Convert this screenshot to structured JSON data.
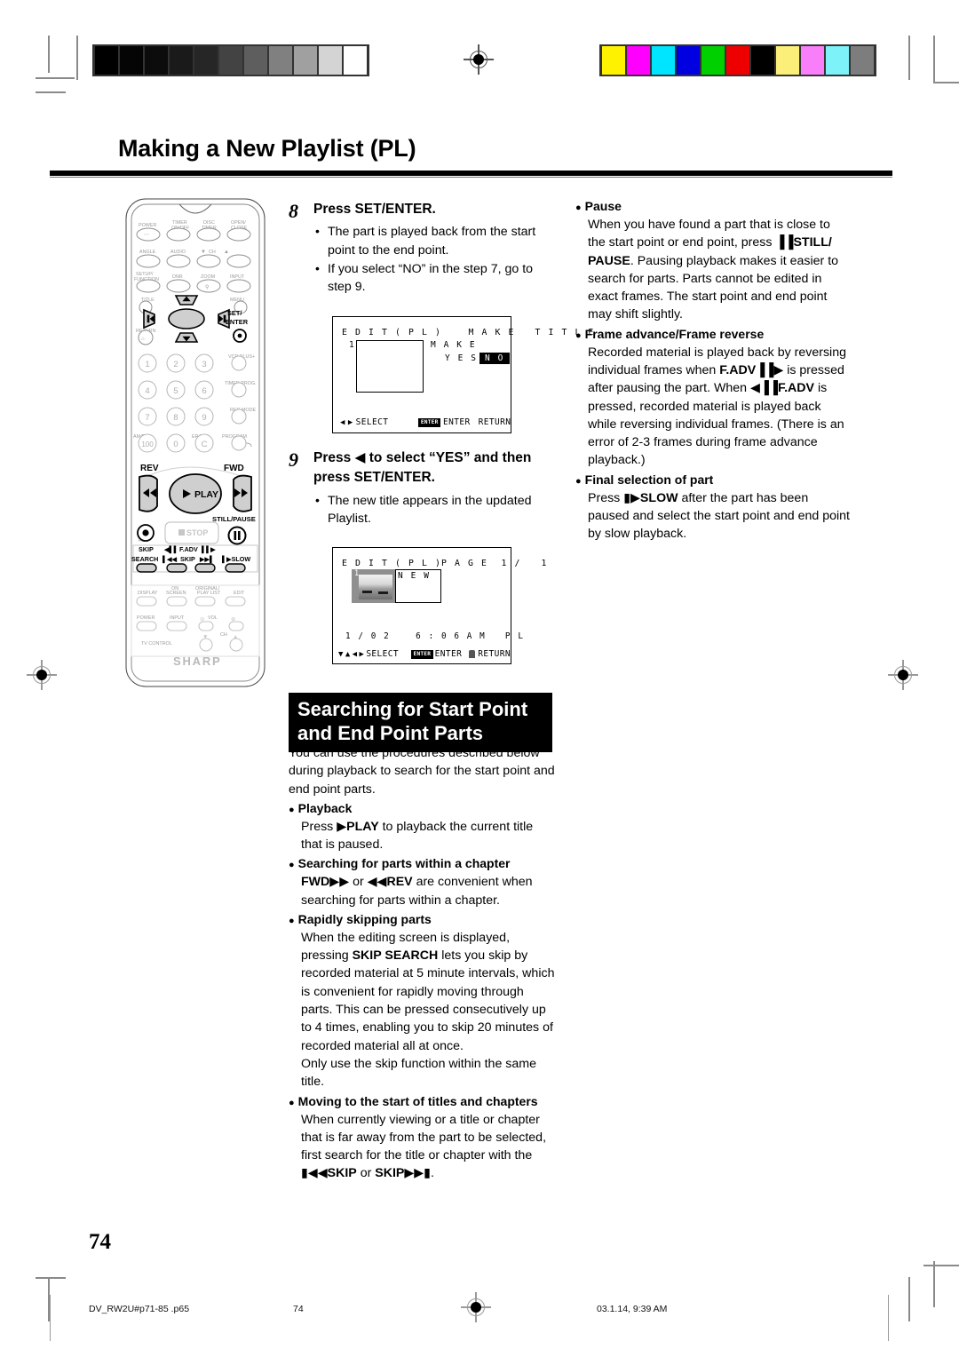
{
  "page": {
    "title": "Making a New Playlist (PL)",
    "number": "74"
  },
  "footer": {
    "filename": "DV_RW2U#p71-85 .p65",
    "page": "74",
    "timestamp": "03.1.14, 9:39 AM"
  },
  "remote": {
    "brand": "SHARP",
    "labels": {
      "power": "POWER",
      "timer_onoff": "TIMER\nON/OFF",
      "disc_timer": "DISC\nTIMER",
      "open_close": "OPEN/\nCLOSE",
      "angle": "ANGLE",
      "audio": "AUDIO",
      "ch": "CH",
      "setup_function": "SETUP/\nFUNCTION",
      "dnr": "DNR",
      "zoom": "ZOOM",
      "input": "INPUT",
      "title": "TITLE",
      "menu": "MENU",
      "return": "RETURN",
      "set_enter": "SET/\nENTER",
      "vcr_plus": "VCR PLUS+",
      "timer_prog": "TIMER PROG.",
      "rec_mode": "REC MODE",
      "am_pm": "AM/PM",
      "erase": "ERASE",
      "program": "PROGRAM",
      "rev": "REV",
      "fwd": "FWD",
      "play": "PLAY",
      "rec": "REC",
      "stop": "STOP",
      "still_pause": "STILL/PAUSE",
      "skip_search": "SKIP\nSEARCH",
      "fadv": "F.ADV",
      "skip": "SKIP",
      "slow": "SLOW",
      "display": "DISPLAY",
      "on_screen": "ON\nSCREEN",
      "original_playlist": "ORIGINAL/\nPLAY LIST",
      "edit": "EDIT",
      "tv_power": "POWER",
      "tv_input": "INPUT",
      "vol": "VOL",
      "tv_ch": "CH",
      "tv_control": "TV CONTROL",
      "numbers": [
        "1",
        "2",
        "3",
        "4",
        "5",
        "6",
        "7",
        "8",
        "9",
        "100",
        "0",
        "C"
      ]
    }
  },
  "steps": [
    {
      "num": "8",
      "head_pre": "Press ",
      "head_bold": "SET/ENTER",
      "head_post": ".",
      "bullets": [
        "The part is played back from the start point to the end point.",
        "If you select “NO” in the step 7, go to step 9."
      ]
    },
    {
      "num": "9",
      "head_line1_pre": "Press ",
      "head_line1_post": " to select “YES” and then",
      "head_line2_pre": "press ",
      "head_line2_bold": "SET/ENTER",
      "head_line2_post": ".",
      "bullets": [
        "The new title appears in the updated Playlist."
      ]
    }
  ],
  "osd1": {
    "title": "E D I T ( P L )    M A K E   T I T L E",
    "index": "1",
    "make_label": "M A K E",
    "yes": "Y E S",
    "no": "N O",
    "footer_select": "SELECT",
    "footer_enter_key": "ENTER",
    "footer_enter": "ENTER",
    "footer_return": "RETURN"
  },
  "osd2": {
    "title": "E D I T ( P L )",
    "page": "P A G E  1 /   1",
    "index": "1",
    "new_title": "N E W",
    "status": "1 / 0 2    6 : 0 6 A M   P L",
    "footer_select": "SELECT",
    "footer_enter_key": "ENTER",
    "footer_enter": "ENTER",
    "footer_return": "RETURN"
  },
  "section": {
    "heading_line1": "Searching for Start Point",
    "heading_line2": "and End Point Parts",
    "intro": "You can use the procedures described below during playback to search for the start point and end point parts.",
    "topics": [
      {
        "title": "Playback",
        "body_pre": "Press ",
        "body_bold": "▶PLAY",
        "body_post": " to playback the current title that is paused."
      },
      {
        "title": "Searching for parts within a chapter",
        "body_b1": "FWD▶▶",
        "body_mid": " or ",
        "body_b2": "◀◀REV",
        "body_post": " are convenient when searching for parts within a chapter."
      },
      {
        "title": "Rapidly skipping parts",
        "body_pre": "When the editing screen is displayed, pressing ",
        "body_bold": "SKIP SEARCH",
        "body_post": " lets you skip by recorded material at 5 minute intervals, which is convenient for rapidly moving through parts. This can be pressed consecutively up to 4 times, enabling you to skip 20 minutes of recorded material all at once.",
        "body_extra": "Only use the skip function within the same title."
      },
      {
        "title": "Moving to the start of titles and chapters",
        "body_pre": "When currently viewing or a title or chapter that is far away from the part to be selected, first search for the title or chapter with the ",
        "body_b1": "▮◀◀SKIP",
        "body_mid": " or ",
        "body_b2": "SKIP▶▶▮",
        "body_post": "."
      }
    ]
  },
  "right_column": {
    "topics": [
      {
        "title": "Pause",
        "body_pre": "When you have found a part that is close to the start point or end point, press ",
        "body_b1": "▐▐STILL/ PAUSE",
        "body_post": ". Pausing playback makes it easier to search for parts. Parts cannot be edited in exact frames. The start point and end point may shift slightly."
      },
      {
        "title": "Frame advance/Frame reverse",
        "body_pre": "Recorded material is played back by reversing individual frames when ",
        "body_b1": "F.ADV▐▐▶",
        "body_mid": " is pressed after pausing the part. When ",
        "body_b2": "◀▐▐F.ADV",
        "body_post": " is pressed, recorded material is played back while reversing individual frames. (There is an error of 2-3 frames during frame advance playback.)"
      },
      {
        "title": "Final selection of part",
        "body_pre": "Press ",
        "body_bold": "▮▶SLOW",
        "body_post": " after the part has been paused and select the start point and end point by slow playback."
      }
    ]
  },
  "marks": {
    "gray_swatches": [
      "#000000",
      "#050505",
      "#0c0c0c",
      "#1a1a1a",
      "#262626",
      "#434343",
      "#5e5e5e",
      "#808080",
      "#a0a0a0",
      "#d4d4d4",
      "#ffffff"
    ],
    "color_swatches": [
      "#fff200",
      "#ff00ff",
      "#00e5ff",
      "#0000e0",
      "#00d000",
      "#ee0000",
      "#000000",
      "#fbef7a",
      "#f97ef9",
      "#7ef2f9",
      "#7d7d7d"
    ]
  }
}
